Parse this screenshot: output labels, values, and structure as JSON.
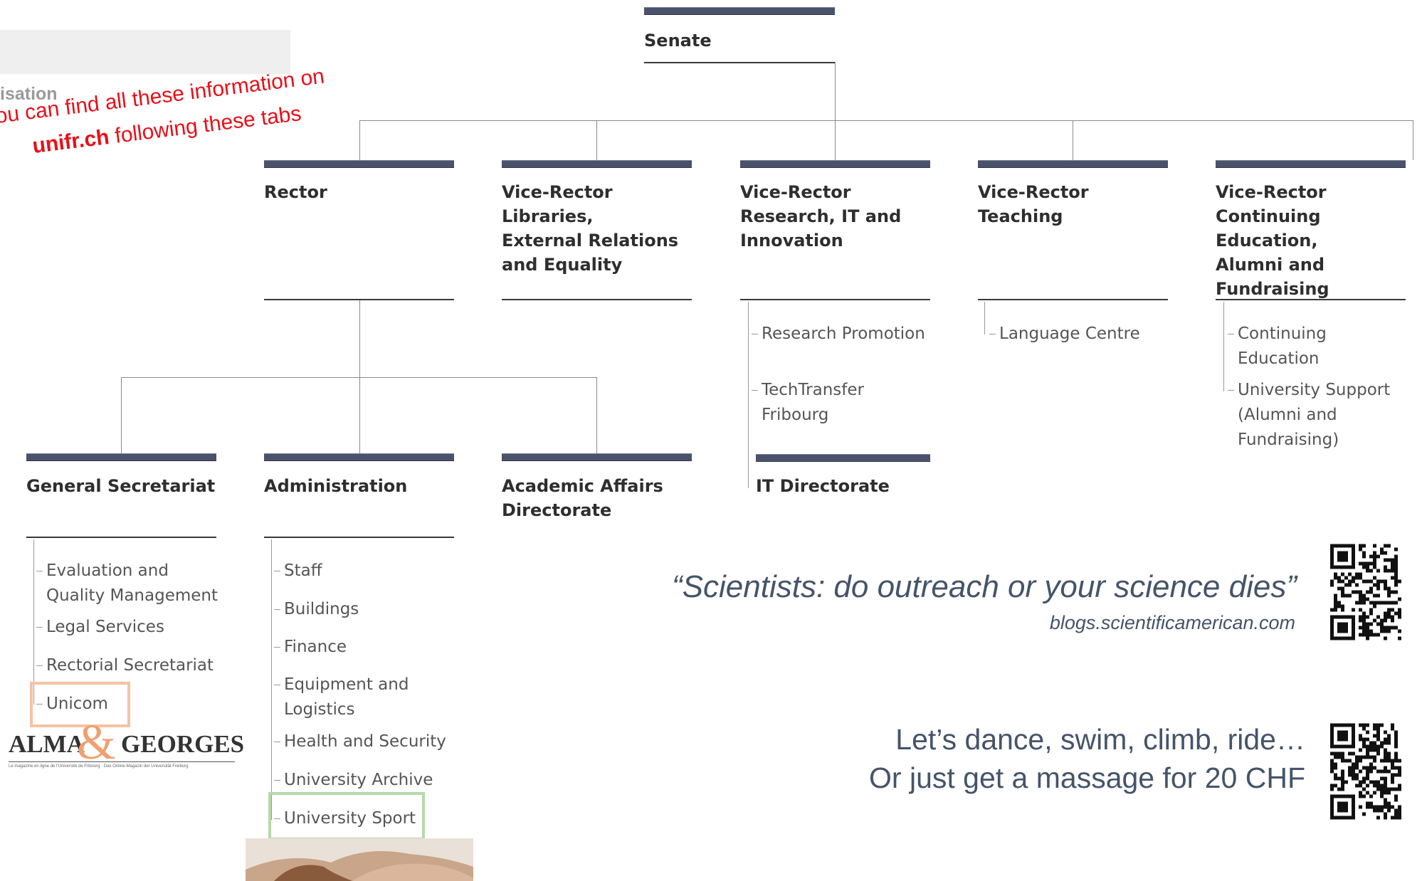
{
  "header_tab": {
    "label": "isation",
    "note_line1": "ou can find all these information on",
    "note_line2_bold": "unifr.ch",
    "note_line2_rest": " following these tabs"
  },
  "org": {
    "senate": "Senate",
    "rector": "Rector",
    "vr_libraries": "Vice-Rector\nLibraries,\nExternal Relations\nand Equality",
    "vr_research": "Vice-Rector\nResearch, IT and\nInnovation",
    "vr_teaching": "Vice-Rector\nTeaching",
    "vr_continuing": "Vice-Rector\nContinuing Education,\nAlumni and\nFundraising",
    "research_items": [
      "Research Promotion",
      "TechTransfer\nFribourg"
    ],
    "it_directorate": "IT Directorate",
    "teaching_items": [
      "Language Centre"
    ],
    "continuing_items": [
      "Continuing\nEducation",
      "University Support\n(Alumni and\nFundraising)"
    ],
    "general_secretariat": "General Secretariat",
    "administration": "Administration",
    "academic_affairs": "Academic Affairs\nDirectorate",
    "gs_items": [
      "Evaluation and\nQuality Management",
      "Legal Services",
      "Rectorial Secretariat",
      "Unicom"
    ],
    "admin_items": [
      "Staff",
      "Buildings",
      "Finance",
      "Equipment and\nLogistics",
      "Health and Security",
      "University Archive",
      "University Sport"
    ]
  },
  "logo": {
    "left": "ALMA",
    "amp": "&",
    "right": "GEORGES",
    "tagline": "Le magazine en ligne de l'Université de Fribourg · Das Online-Magazin der Universität Freiburg"
  },
  "quote": {
    "text": "“Scientists: do outreach or your science dies”",
    "source": "blogs.scientificamerican.com"
  },
  "sport": {
    "line1": "Let’s dance, swim, climb, ride…",
    "line2": "Or just get a massage for 20 CHF"
  },
  "colors": {
    "bar": "#4a526c",
    "highlight_orange": "#f4c3a3",
    "highlight_green": "#b6d9a8",
    "note_red": "#e8101a",
    "quote_blue": "#44546a"
  }
}
